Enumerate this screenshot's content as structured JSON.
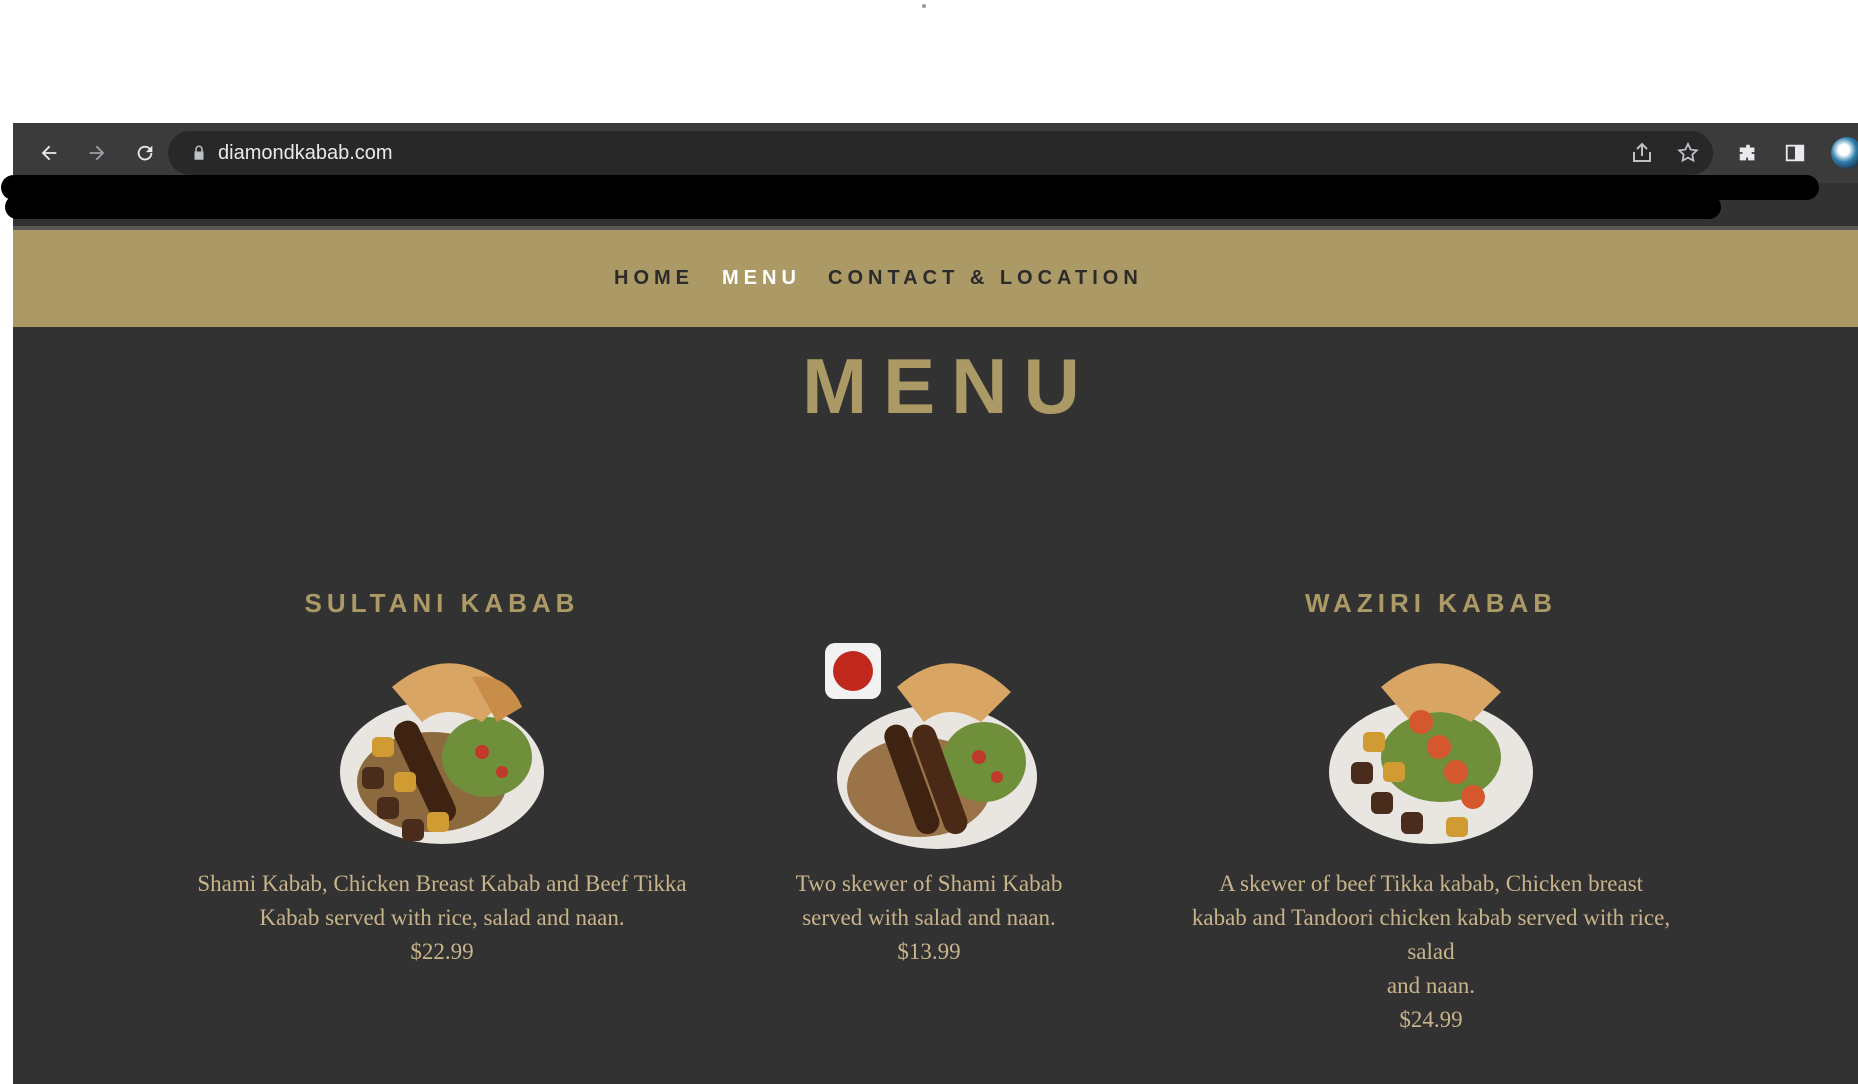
{
  "browser": {
    "url": "diamondkabab.com",
    "icons": [
      "back-icon",
      "forward-icon",
      "reload-icon",
      "lock-icon",
      "share-icon",
      "star-icon",
      "extensions-icon",
      "side-panel-icon",
      "profile-avatar"
    ]
  },
  "nav": {
    "items": [
      {
        "label": "HOME"
      },
      {
        "label": "MENU",
        "active": true
      },
      {
        "label": "CONTACT & LOCATION"
      }
    ]
  },
  "page": {
    "title": "MENU"
  },
  "menu_items": [
    {
      "name": "SULTANI KABAB",
      "description": "Shami Kabab, Chicken Breast Kabab and Beef Tikka Kabab served with rice, salad and naan.",
      "price": "$22.99"
    },
    {
      "name": "",
      "description": "Two skewer of Shami Kabab served with salad and naan.",
      "price": "$13.99"
    },
    {
      "name": "WAZIRI KABAB",
      "description_lines": [
        "A skewer of beef Tikka kabab, Chicken breast kabab and Tandoori chicken kabab served with rice, salad",
        "and naan."
      ],
      "price": "$24.99"
    }
  ],
  "colors": {
    "nav_bg": "#ab9966",
    "page_bg": "#323232",
    "accent": "#ab9966",
    "text": "#c8b48a"
  }
}
